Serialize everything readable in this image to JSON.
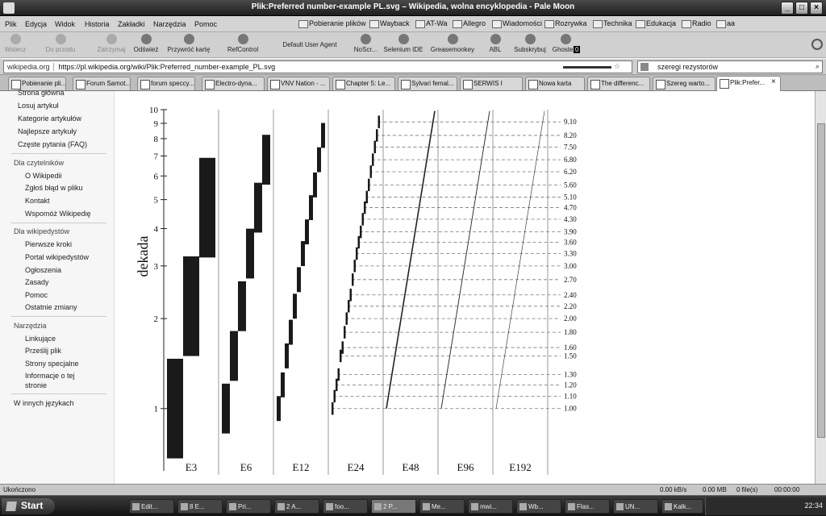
{
  "window": {
    "title": "Plik:Preferred number-example PL.svg – Wikipedia, wolna encyklopedia - Pale Moon",
    "minimize": "_",
    "maximize": "□",
    "close": "×"
  },
  "menu": [
    "Plik",
    "Edycja",
    "Widok",
    "Historia",
    "Zakładki",
    "Narzędzia",
    "Pomoc"
  ],
  "bookmarks": [
    "Pobieranie plików",
    "Wayback",
    "AT-Wa",
    "Allegro",
    "Wiadomości",
    "Rozrywka",
    "Technika",
    "Edukacja",
    "Radio",
    "aa"
  ],
  "toolbar": {
    "back": "Wstecz",
    "forward": "Do przodu",
    "stop": "Zatrzymaj",
    "reload": "Odśwież",
    "restore_tab": "Przywróć kartę",
    "refcontrol": "RefControl",
    "user_agent": "Default User Agent",
    "noscript": "NoScr...",
    "selenium": "Selenium IDE",
    "greasemonkey": "Greasemonkey",
    "abl": "ABL",
    "subscribe": "Subskrybuj",
    "ghostery": "Ghostery",
    "ghostery_count": "0"
  },
  "address": {
    "site": "wikipedia.org",
    "url": "https://pl.wikipedia.org/wiki/Plik:Preferred_number-example_PL.svg"
  },
  "search": {
    "value": "szeregi rezystorów"
  },
  "tabs": [
    "Pobieranie pli...",
    "Forum Samot...",
    "forum speccy...",
    "Electro-dyna...",
    "VNV Nation - ...",
    "Chapter 5: Le...",
    "Sylvari femal...",
    "SERWIS I",
    "Nowa karta",
    "The differenc...",
    "Szereg warto...",
    "Plik:Prefer..."
  ],
  "sidebar": {
    "nav": [
      "Strona główna",
      "Losuj artykuł",
      "Kategorie artykułów",
      "Najlepsze artykuły",
      "Częste pytania (FAQ)"
    ],
    "readers_heading": "Dla czytelników",
    "readers": [
      "O Wikipedii",
      "Zgłoś błąd w pliku",
      "Kontakt",
      "Wspomóż Wikipedię"
    ],
    "editors_heading": "Dla wikipedystów",
    "editors": [
      "Pierwsze kroki",
      "Portal wikipedystów",
      "Ogłoszenia",
      "Zasady",
      "Pomoc",
      "Ostatnie zmiany"
    ],
    "tools_heading": "Narzędzia",
    "tools": [
      "Linkujące",
      "Prześlij plik",
      "Strony specjalne",
      "Informacje o tej",
      "stronie"
    ],
    "languages": "W innych językach"
  },
  "chart_data": {
    "type": "bar",
    "title": "",
    "xlabel": "",
    "ylabel": "dekada",
    "yscale": "log",
    "ylim": [
      0.6,
      10
    ],
    "yticks": [
      "1",
      "2",
      "3",
      "4",
      "5",
      "6",
      "7",
      "8",
      "9",
      "10"
    ],
    "categories": [
      "E3",
      "E6",
      "E12",
      "E24",
      "E48",
      "E96",
      "E192"
    ],
    "series": [
      {
        "values": [
          1.0,
          2.2,
          4.7
        ]
      },
      {
        "values": [
          1.0,
          1.5,
          2.2,
          3.3,
          4.7,
          6.8
        ]
      },
      {
        "values": [
          1.0,
          1.2,
          1.5,
          1.8,
          2.2,
          2.7,
          3.3,
          3.9,
          4.7,
          5.6,
          6.8,
          8.2
        ]
      },
      {
        "values": [
          1.0,
          1.1,
          1.2,
          1.3,
          1.5,
          1.6,
          1.8,
          2.0,
          2.2,
          2.4,
          2.7,
          3.0,
          3.3,
          3.6,
          3.9,
          4.3,
          4.7,
          5.1,
          5.6,
          6.2,
          6.8,
          7.5,
          8.2,
          9.1
        ]
      }
    ],
    "dense_series": [
      48,
      96,
      192
    ],
    "right_labels": [
      "9.10",
      "8.20",
      "7.50",
      "6.80",
      "6.20",
      "5.60",
      "5.10",
      "4.70",
      "4.30",
      "3.90",
      "3.60",
      "3.30",
      "3.00",
      "2.70",
      "2.40",
      "2.20",
      "2.00",
      "1.80",
      "1.60",
      "1.50",
      "1.30",
      "1.20",
      "1.10",
      "1.00"
    ]
  },
  "status": {
    "text": "Ukończono",
    "speed": "0.00 kB/s",
    "mem": "0.00 MB",
    "files": "0 file(s)",
    "time": "00:00:00"
  },
  "taskbar": {
    "start": "Start",
    "items": [
      "Edit...",
      "8 E...",
      "Pri...",
      "2 A...",
      "foo...",
      "2 P...",
      "Me...",
      "mwi...",
      "Wb...",
      "Flas...",
      "UN...",
      "Kalk..."
    ],
    "clock": "22:34"
  }
}
